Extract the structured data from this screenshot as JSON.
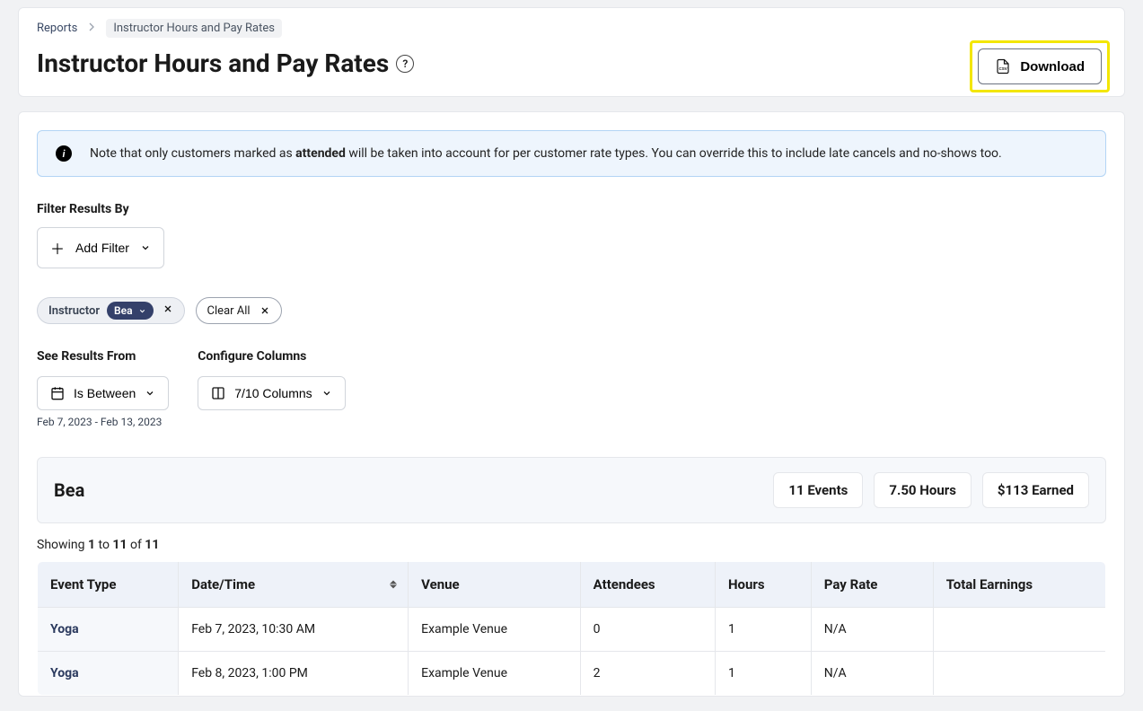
{
  "breadcrumb": {
    "root": "Reports",
    "current": "Instructor Hours and Pay Rates"
  },
  "page_title": "Instructor Hours and Pay Rates",
  "download_label": "Download",
  "info_banner": {
    "prefix": "Note that only customers marked as ",
    "bold": "attended",
    "suffix": " will be taken into account for per customer rate types. You can override this to include late cancels and no-shows too."
  },
  "filter_section": {
    "label": "Filter Results By",
    "add_filter": "Add Filter"
  },
  "active_filter": {
    "name": "Instructor",
    "value": "Bea"
  },
  "clear_all": "Clear All",
  "see_results": {
    "label": "See Results From",
    "value": "Is Between",
    "date_range": "Feb 7, 2023 - Feb 13, 2023"
  },
  "configure_columns": {
    "label": "Configure Columns",
    "value": "7/10 Columns"
  },
  "summary": {
    "name": "Bea",
    "events": "11 Events",
    "hours": "7.50 Hours",
    "earned": "$113 Earned"
  },
  "showing": {
    "prefix": "Showing ",
    "from": "1",
    "mid1": " to ",
    "to": "11",
    "mid2": " of ",
    "total": "11"
  },
  "table": {
    "headers": {
      "event_type": "Event Type",
      "date_time": "Date/Time",
      "venue": "Venue",
      "attendees": "Attendees",
      "hours": "Hours",
      "pay_rate": "Pay Rate",
      "total_earnings": "Total Earnings"
    },
    "rows": [
      {
        "event_type": "Yoga",
        "date_time": "Feb 7, 2023, 10:30 AM",
        "venue": "Example Venue",
        "attendees": "0",
        "hours": "1",
        "pay_rate": "N/A",
        "total_earnings": ""
      },
      {
        "event_type": "Yoga",
        "date_time": "Feb 8, 2023, 1:00 PM",
        "venue": "Example Venue",
        "attendees": "2",
        "hours": "1",
        "pay_rate": "N/A",
        "total_earnings": ""
      }
    ]
  }
}
